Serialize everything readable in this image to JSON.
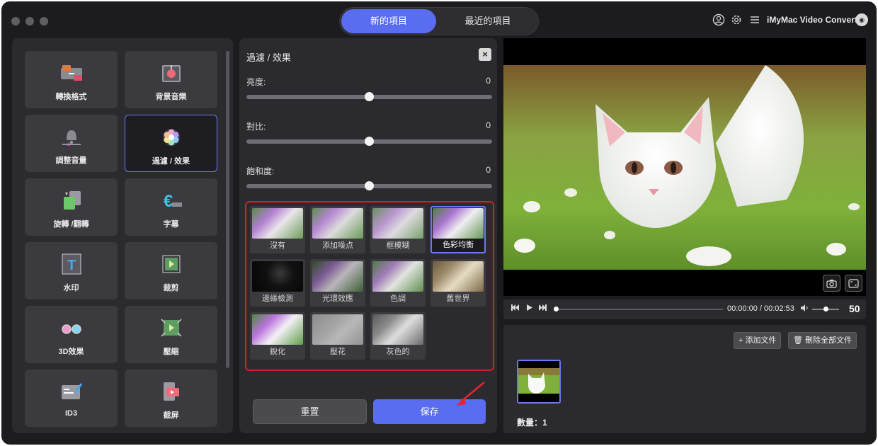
{
  "header": {
    "tabs": [
      {
        "label": "新的項目",
        "active": true
      },
      {
        "label": "最近的項目",
        "active": false
      }
    ],
    "brand": "iMyMac Video Converter"
  },
  "sidebar": {
    "tools": [
      {
        "label": "轉換格式",
        "icon": "convert-format-icon"
      },
      {
        "label": "背景音樂",
        "icon": "background-music-icon"
      },
      {
        "label": "調整音量",
        "icon": "volume-adjust-icon"
      },
      {
        "label": "過濾 / 效果",
        "icon": "filter-effect-icon",
        "selected": true
      },
      {
        "label": "旋轉 /翻轉",
        "icon": "rotate-flip-icon"
      },
      {
        "label": "字幕",
        "icon": "subtitle-icon"
      },
      {
        "label": "水印",
        "icon": "watermark-icon"
      },
      {
        "label": "裁剪",
        "icon": "crop-icon"
      },
      {
        "label": "3D效果",
        "icon": "3d-glasses-icon"
      },
      {
        "label": "壓縮",
        "icon": "compress-icon"
      },
      {
        "label": "ID3",
        "icon": "id3-tag-icon"
      },
      {
        "label": "截屏",
        "icon": "screenshot-icon"
      }
    ]
  },
  "filter_panel": {
    "title": "過濾 / 效果",
    "close_label": "×",
    "sliders": [
      {
        "label": "亮度:",
        "value": "0",
        "level": 0.5
      },
      {
        "label": "對比:",
        "value": "0",
        "level": 0.5
      },
      {
        "label": "飽和度:",
        "value": "0",
        "level": 0.5
      }
    ],
    "effects": [
      {
        "label": "沒有"
      },
      {
        "label": "添加噪点"
      },
      {
        "label": "框模糊"
      },
      {
        "label": "色彩均衡",
        "selected": true
      },
      {
        "label": "邊緣檢測"
      },
      {
        "label": "光環效應"
      },
      {
        "label": "色調"
      },
      {
        "label": "舊世界"
      },
      {
        "label": "銳化"
      },
      {
        "label": "壓花"
      },
      {
        "label": "灰色的"
      }
    ],
    "reset_label": "重置",
    "save_label": "保存"
  },
  "player": {
    "time": "00:00:00 / 00:02:53",
    "volume": "50",
    "progress": 0,
    "volume_level": 0.5
  },
  "files": {
    "add_label": "添加文件",
    "delete_all_label": "刪除全部文件",
    "count_label": "數量：",
    "count": "1"
  },
  "colors": {
    "accent": "#5a6cf0",
    "highlight_border": "#d41e2a",
    "panel": "#2b2b2f",
    "background": "#1c1c1f"
  }
}
